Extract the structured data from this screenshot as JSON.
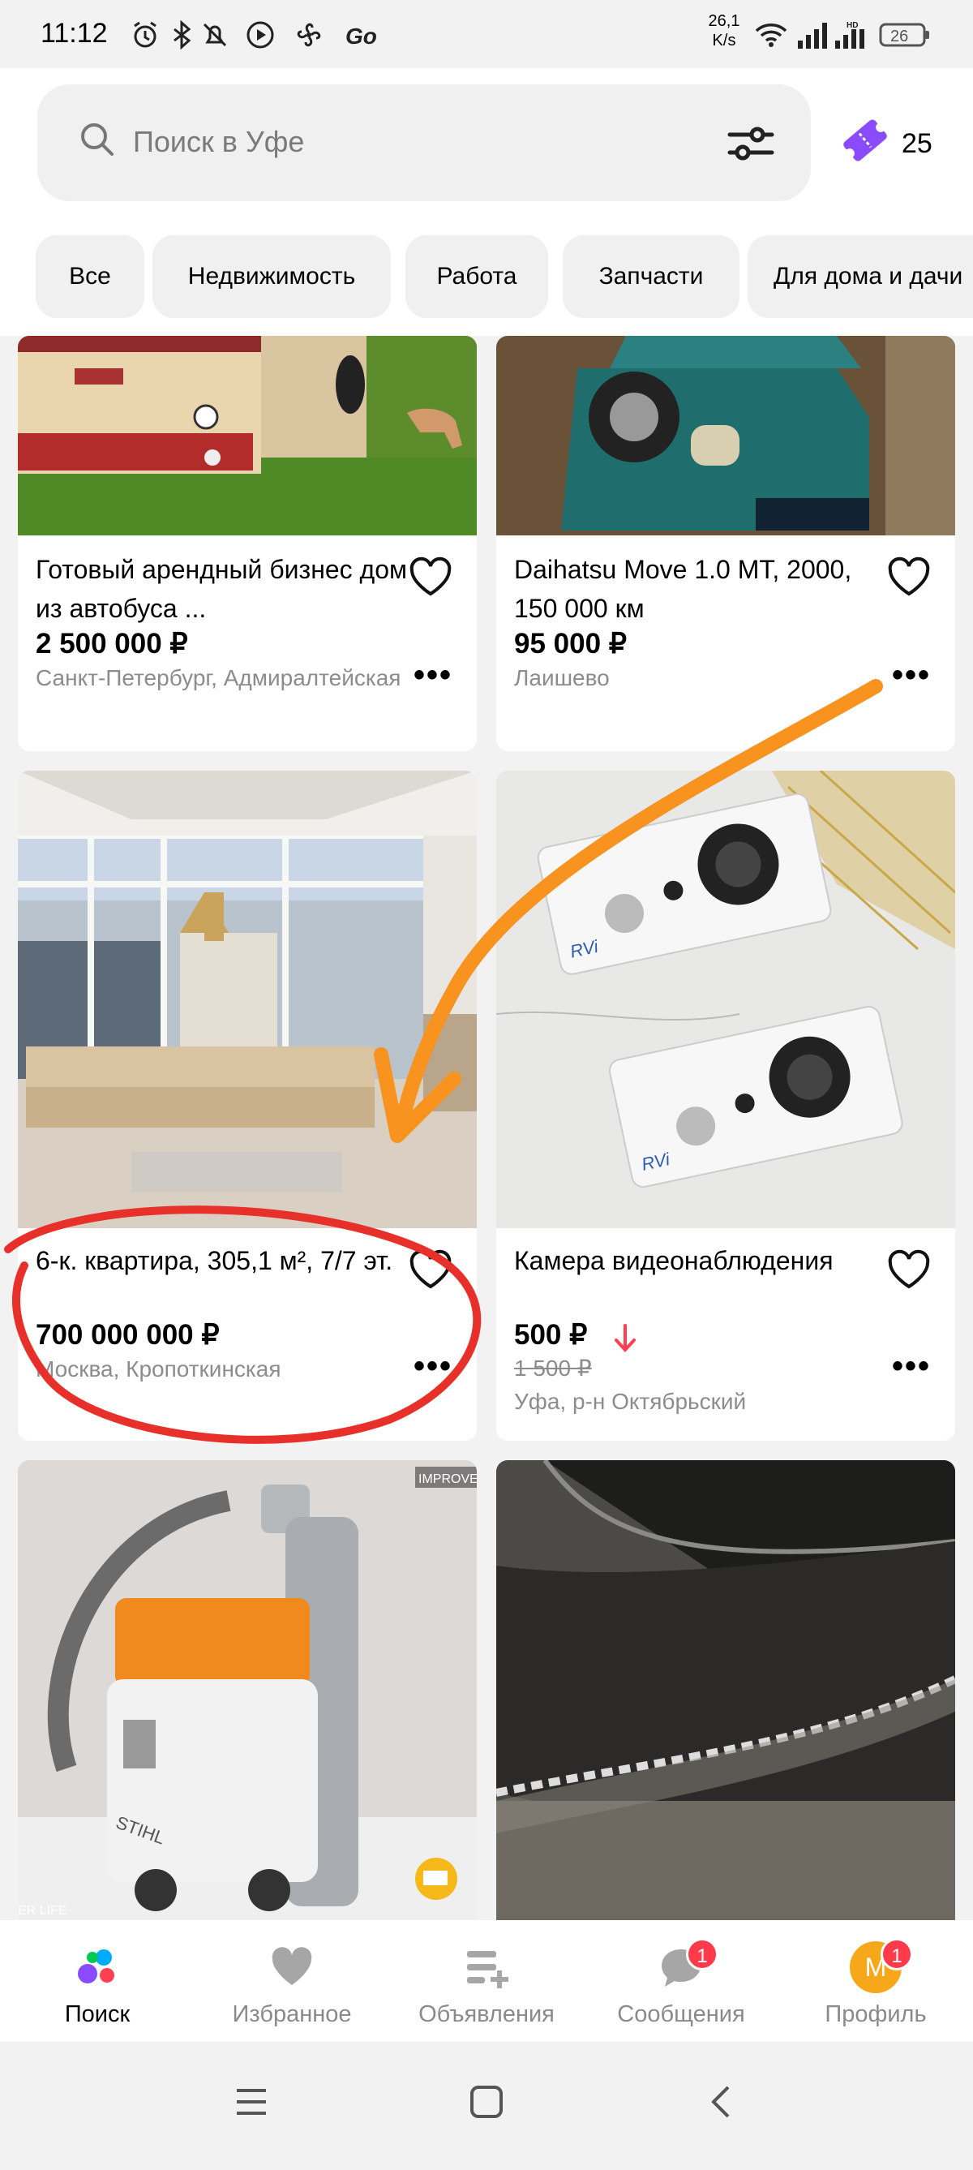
{
  "status_bar": {
    "time": "11:12",
    "speed_value": "26,1",
    "speed_unit": "K/s",
    "battery": "26",
    "icons": [
      "alarm-icon",
      "bluetooth-icon",
      "mute-icon",
      "play-icon",
      "fan-icon",
      "go-icon",
      "wifi-icon",
      "signal-icon",
      "hd-signal-icon",
      "battery-icon"
    ]
  },
  "search": {
    "placeholder": "Поиск в Уфе"
  },
  "tickets": {
    "count": "25"
  },
  "categories": [
    {
      "label": "Все"
    },
    {
      "label": "Недвижимость"
    },
    {
      "label": "Работа"
    },
    {
      "label": "Запчасти"
    },
    {
      "label": "Для дома и дачи"
    }
  ],
  "listings": [
    {
      "title": "Готовый арендный бизнес дом из автобуса ...",
      "price": "2 500 000 ₽",
      "location": "Санкт-Петербург, Адмиралтейская",
      "image": "bus-photo"
    },
    {
      "title": "Daihatsu Move 1.0 MT, 2000, 150 000 км",
      "price": "95 000 ₽",
      "location": "Лаишево",
      "image": "car-photo"
    },
    {
      "title": "6-к. квартира, 305,1 м², 7/7 эт.",
      "price": "700 000 000 ₽",
      "location": "Москва, Кропоткинская",
      "image": "apartment-photo"
    },
    {
      "title": "Камера видеонаблюдения",
      "price": "500 ₽",
      "old_price": "1 500 ₽",
      "location": "Уфа, р-н Октябрьский",
      "image": "camera-photo"
    },
    {
      "image": "vacuum-photo",
      "watermark": "IMPROVE",
      "watermark2": "ER LIFE"
    },
    {
      "image": "car-door-photo"
    }
  ],
  "bottom_nav": [
    {
      "label": "Поиск",
      "icon": "search-dots-icon",
      "active": true
    },
    {
      "label": "Избранное",
      "icon": "heart-icon"
    },
    {
      "label": "Объявления",
      "icon": "listings-icon"
    },
    {
      "label": "Сообщения",
      "icon": "chat-icon",
      "badge": "1"
    },
    {
      "label": "Профиль",
      "icon": "avatar-icon",
      "badge": "1",
      "avatar_letter": "М"
    }
  ],
  "colors": {
    "accent_purple": "#8a4bff",
    "price_drop": "#ff4053",
    "annotation_orange": "#f7931e",
    "annotation_red": "#e8302a"
  }
}
